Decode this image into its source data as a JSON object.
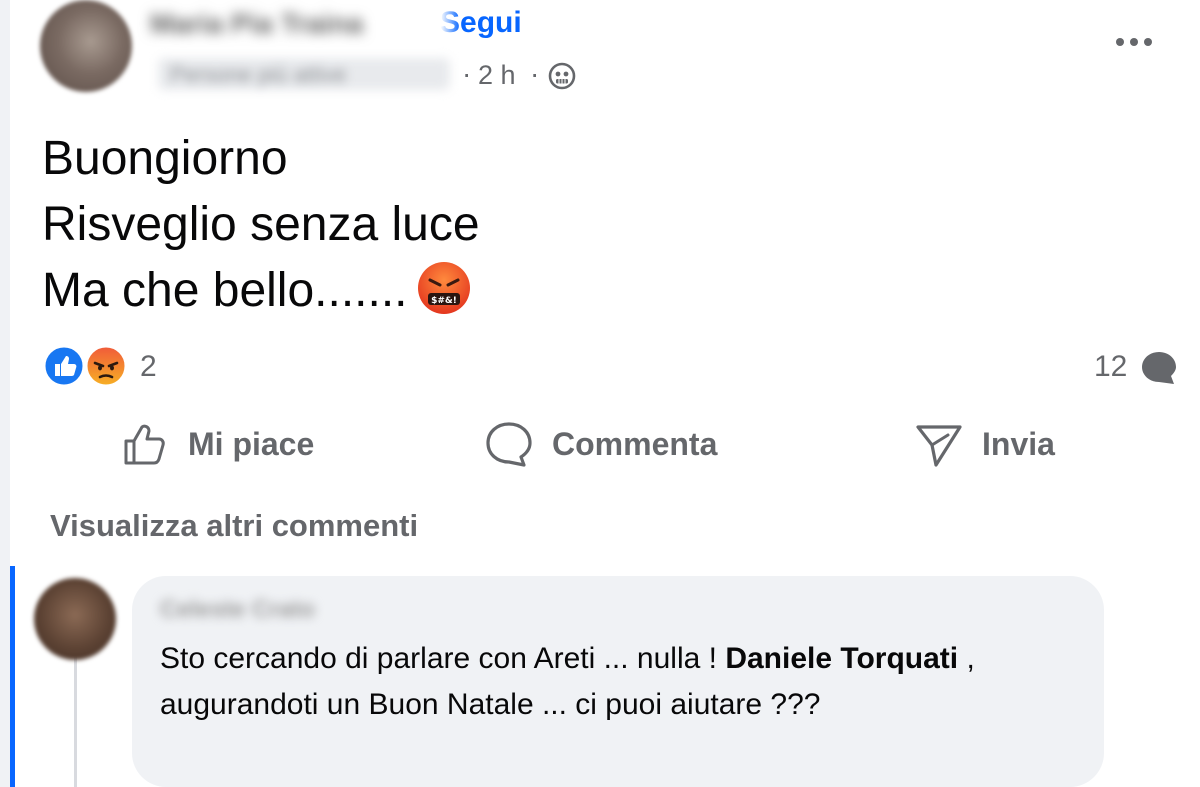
{
  "post": {
    "author_name": "Maria Pia Traina",
    "follow_label": "Segui",
    "audience": "Persone più attive",
    "time": "2 h",
    "dot": "·",
    "lines": [
      "Buongiorno",
      "Risveglio senza luce",
      "Ma che bello......."
    ],
    "end_emoji": "angry-cursing-face",
    "reactions": {
      "icons": [
        "like-icon",
        "angry-icon"
      ],
      "count": "2"
    },
    "comments_count": "12",
    "actions": {
      "like": "Mi piace",
      "comment": "Commenta",
      "send": "Invia"
    },
    "view_more_comments": "Visualizza altri commenti"
  },
  "comment": {
    "author_name": "Celeste Crato",
    "text_before": "Sto cercando di parlare con Areti ... nulla ! ",
    "mention": "Daniele Torquati",
    "text_after": " , augurandoti un Buon Natale ... ci puoi aiutare ???"
  },
  "colors": {
    "primary_text": "#080809",
    "secondary_text": "#65676b",
    "link_blue": "#0866ff",
    "bubble_bg": "#f0f2f5"
  }
}
